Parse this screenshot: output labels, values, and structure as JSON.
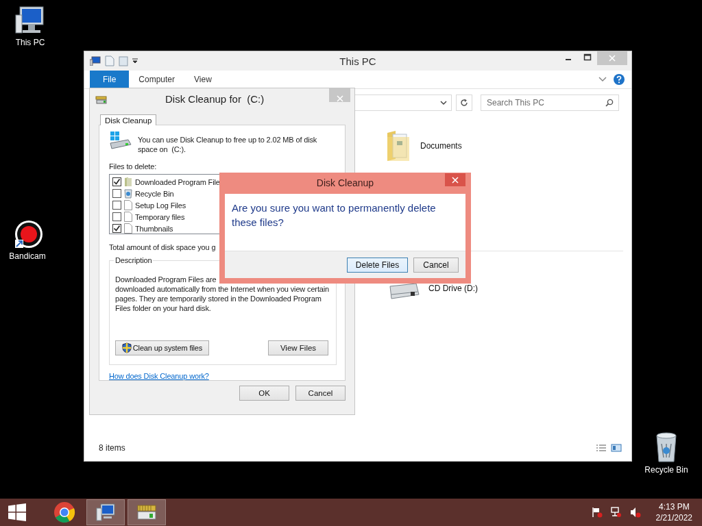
{
  "desktop_icons": [
    {
      "label": "This PC",
      "kind": "computer"
    },
    {
      "label": "Bandicam",
      "kind": "record"
    },
    {
      "label": "Recycle Bin",
      "kind": "bin"
    }
  ],
  "explorer": {
    "title": "This PC",
    "ribbon_tabs": [
      {
        "label": "File",
        "selected": true
      },
      {
        "label": "Computer",
        "selected": false
      },
      {
        "label": "View",
        "selected": false
      }
    ],
    "search": {
      "placeholder": "Search This PC"
    },
    "items": [
      {
        "label": "Documents",
        "kind": "folder"
      },
      {
        "label": "CD Drive (D:)",
        "kind": "drive"
      }
    ],
    "status_bar": "8 items"
  },
  "disk_cleanup": {
    "title": "Disk Cleanup for  (C:)",
    "tabs": [
      {
        "label": "Disk Cleanup",
        "selected": true
      }
    ],
    "intro": "You can use Disk Cleanup to free up to 2.02 MB of disk space on  (C:).",
    "files_label": "Files to delete:",
    "files": [
      {
        "name": "Downloaded Program File",
        "checked": true,
        "kind": "folder"
      },
      {
        "name": "Recycle Bin",
        "checked": false,
        "kind": "bin"
      },
      {
        "name": "Setup Log Files",
        "checked": false,
        "kind": "file"
      },
      {
        "name": "Temporary files",
        "checked": false,
        "kind": "file"
      },
      {
        "name": "Thumbnails",
        "checked": true,
        "kind": "file"
      }
    ],
    "total_label": "Total amount of disk space you g",
    "description_title": "Description",
    "description_lines": [
      "Downloaded Program Files are",
      "downloaded automatically from the Internet when you view certain",
      "pages. They are temporarily stored in the Downloaded Program",
      "Files folder on your hard disk."
    ],
    "panel_buttons": [
      {
        "label": "Clean up system files",
        "kind": "shield"
      },
      {
        "label": "View Files",
        "kind": "plain"
      }
    ],
    "help_link": "How does Disk Cleanup work?",
    "footer_buttons": [
      "OK",
      "Cancel"
    ]
  },
  "confirm": {
    "title": "Disk Cleanup",
    "message": "Are you sure you want to permanently delete these files?",
    "buttons": [
      {
        "label": "Delete Files",
        "default": true
      },
      {
        "label": "Cancel",
        "default": false
      }
    ]
  },
  "taskbar": {
    "apps": [
      {
        "kind": "browser",
        "running": false
      },
      {
        "kind": "explorer",
        "running": true
      },
      {
        "kind": "cleanup",
        "running": true
      }
    ],
    "clock": {
      "time": "4:13 PM",
      "date": "2/21/2022"
    }
  }
}
